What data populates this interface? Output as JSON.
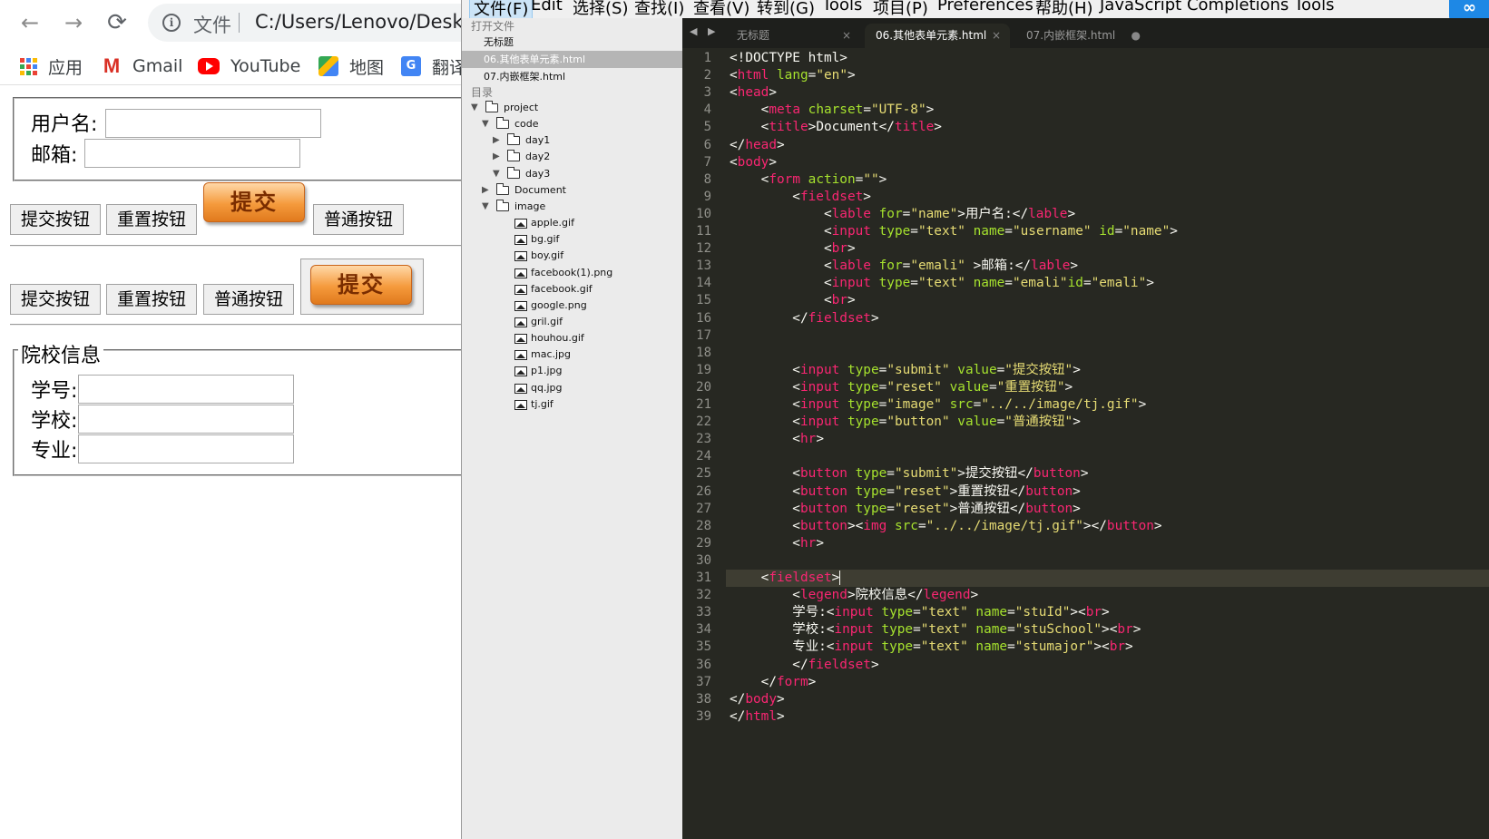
{
  "browser": {
    "nav": {
      "back": "←",
      "forward": "→",
      "reload": "⟳"
    },
    "omnibox": {
      "info": "i",
      "label": "文件",
      "url": "C:/Users/Lenovo/Desktop"
    },
    "bookmarks": [
      {
        "label": "应用"
      },
      {
        "label": "Gmail"
      },
      {
        "label": "YouTube"
      },
      {
        "label": "地图"
      },
      {
        "label": "翻译"
      }
    ],
    "form": {
      "username_label": "用户名:",
      "email_label": "邮箱:",
      "row1": {
        "submit": "提交按钮",
        "reset": "重置按钮",
        "image": "提交",
        "button": "普通按钮"
      },
      "row2": {
        "submit": "提交按钮",
        "reset": "重置按钮",
        "button": "普通按钮",
        "image": "提交"
      },
      "fieldset2": {
        "legend": "院校信息",
        "student_id": "学号:",
        "school": "学校:",
        "major": "专业:"
      }
    }
  },
  "editor": {
    "menu": [
      "文件(F)",
      "Edit",
      "选择(S)",
      "查找(I)",
      "查看(V)",
      "转到(G)",
      "Tools",
      "项目(P)",
      "Preferences",
      "帮助(H)",
      "JavaScript Completions Tools"
    ],
    "sidebar": {
      "open_files_header": "打开文件",
      "open_files": [
        "无标题",
        "06.其他表单元素.html",
        "07.内嵌框架.html"
      ],
      "folders_header": "目录",
      "tree": [
        {
          "name": "project",
          "type": "folder",
          "depth": 0,
          "open": true
        },
        {
          "name": "code",
          "type": "folder",
          "depth": 1,
          "open": true
        },
        {
          "name": "day1",
          "type": "folder",
          "depth": 2,
          "open": false
        },
        {
          "name": "day2",
          "type": "folder",
          "depth": 2,
          "open": false
        },
        {
          "name": "day3",
          "type": "folder",
          "depth": 2,
          "open": true
        },
        {
          "name": "Document",
          "type": "folder",
          "depth": 1,
          "open": false
        },
        {
          "name": "image",
          "type": "folder",
          "depth": 1,
          "open": true
        },
        {
          "name": "apple.gif",
          "type": "image",
          "depth": 2
        },
        {
          "name": "bg.gif",
          "type": "image",
          "depth": 2
        },
        {
          "name": "boy.gif",
          "type": "image",
          "depth": 2
        },
        {
          "name": "facebook(1).png",
          "type": "image",
          "depth": 2
        },
        {
          "name": "facebook.gif",
          "type": "image",
          "depth": 2
        },
        {
          "name": "google.png",
          "type": "image",
          "depth": 2
        },
        {
          "name": "gril.gif",
          "type": "image",
          "depth": 2
        },
        {
          "name": "houhou.gif",
          "type": "image",
          "depth": 2
        },
        {
          "name": "mac.jpg",
          "type": "image",
          "depth": 2
        },
        {
          "name": "p1.jpg",
          "type": "image",
          "depth": 2
        },
        {
          "name": "qq.jpg",
          "type": "image",
          "depth": 2
        },
        {
          "name": "tj.gif",
          "type": "image",
          "depth": 2
        }
      ]
    },
    "tabs": [
      {
        "label": "无标题",
        "close": "×"
      },
      {
        "label": "06.其他表单元素.html",
        "close": "×"
      },
      {
        "label": "07.内嵌框架.html",
        "close": "●"
      }
    ],
    "code_lines": [
      "<!DOCTYPE html>",
      "<html lang=\"en\">",
      "<head>",
      "    <meta charset=\"UTF-8\">",
      "    <title>Document</title>",
      "</head>",
      "<body>",
      "    <form action=\"\">",
      "        <fieldset>",
      "            <lable for=\"name\">用户名:</lable>",
      "            <input type=\"text\" name=\"username\" id=\"name\">",
      "            <br>",
      "            <lable for=\"emali\" >邮箱:</lable>",
      "            <input type=\"text\" name=\"emali\"id=\"emali\">",
      "            <br>",
      "        </fieldset>",
      "",
      "",
      "        <input type=\"submit\" value=\"提交按钮\">",
      "        <input type=\"reset\" value=\"重置按钮\">",
      "        <input type=\"image\" src=\"../../image/tj.gif\">",
      "        <input type=\"button\" value=\"普通按钮\">",
      "        <hr>",
      "",
      "        <button type=\"submit\">提交按钮</button>",
      "        <button type=\"reset\">重置按钮</button>",
      "        <button type=\"reset\">普通按钮</button>",
      "        <button><img src=\"../../image/tj.gif\"></button>",
      "        <hr>",
      "",
      "    <fieldset>",
      "        <legend>院校信息</legend>",
      "        学号:<input type=\"text\" name=\"stuId\"><br>",
      "        学校:<input type=\"text\" name=\"stuSchool\"><br>",
      "        专业:<input type=\"text\" name=\"stumajor\"><br>",
      "        </fieldset>",
      "    </form>",
      "</body>",
      "</html>"
    ],
    "current_line": 31,
    "colors": {
      "bg": "#272822",
      "tag": "#f92672",
      "attr": "#a6e22e",
      "string": "#e6db74",
      "text": "#f8f8f2"
    }
  }
}
